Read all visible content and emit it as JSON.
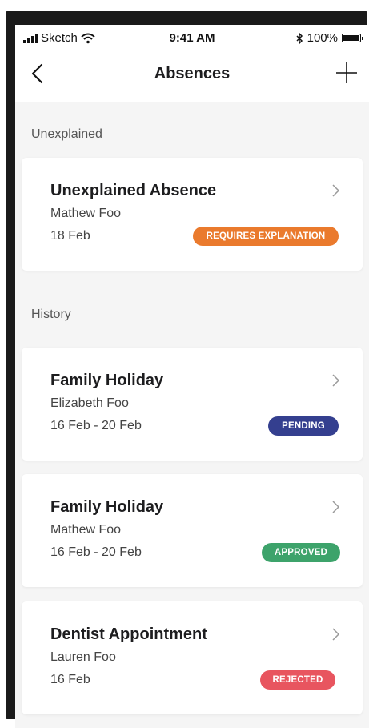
{
  "status_bar": {
    "carrier": "Sketch",
    "time": "9:41 AM",
    "battery": "100%"
  },
  "header": {
    "title": "Absences",
    "back_icon": "chevron-left-icon",
    "add_icon": "plus-icon"
  },
  "sections": {
    "unexplained": {
      "label": "Unexplained",
      "items": [
        {
          "title": "Unexplained Absence",
          "name": "Mathew Foo",
          "date": "18 Feb",
          "status": "REQUIRES EXPLANATION",
          "status_color": "#EA7A2D"
        }
      ]
    },
    "history": {
      "label": "History",
      "items": [
        {
          "title": "Family Holiday",
          "name": "Elizabeth Foo",
          "date": "16 Feb - 20 Feb",
          "status": "PENDING",
          "status_color": "#343F8F"
        },
        {
          "title": "Family Holiday",
          "name": "Mathew Foo",
          "date": "16 Feb - 20 Feb",
          "status": "APPROVED",
          "status_color": "#3DA36B"
        },
        {
          "title": "Dentist Appointment",
          "name": "Lauren Foo",
          "date": "16 Feb",
          "status": "REJECTED",
          "status_color": "#E8555F"
        }
      ]
    }
  },
  "colors": {
    "background": "#F5F5F5",
    "card": "#FFFFFF",
    "title_text": "#1D1D1F",
    "secondary_text": "#444444"
  }
}
